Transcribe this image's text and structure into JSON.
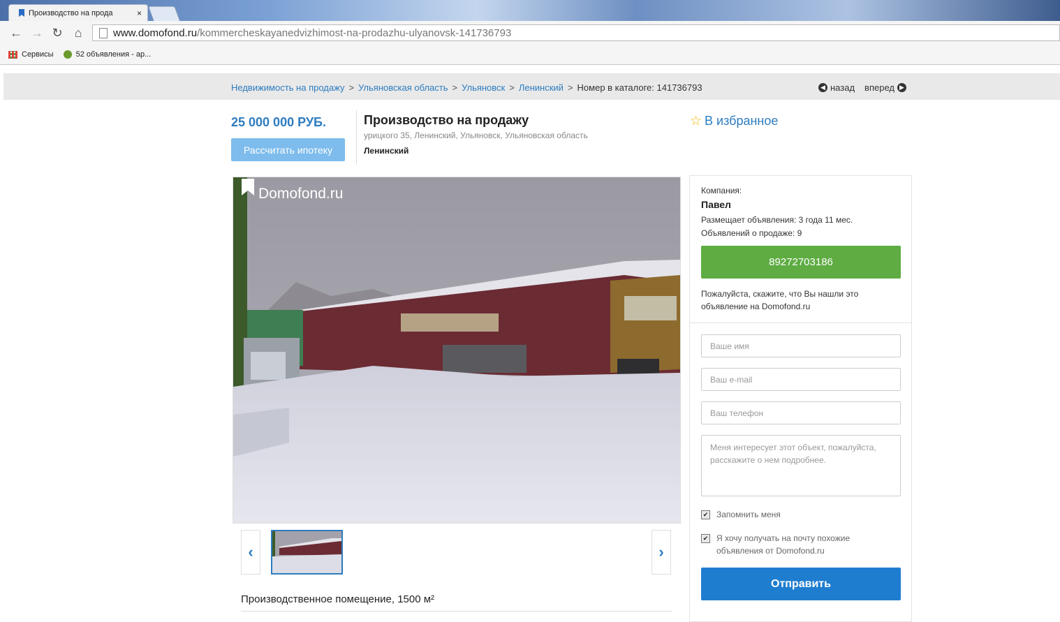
{
  "browser": {
    "tab_title": "Производство на прода",
    "tab_close": "×",
    "url_host": "www.domofond.ru",
    "url_path": "/kommercheskayanedvizhimost-na-prodazhu-ulyanovsk-141736793",
    "bookmarks": [
      {
        "label": "Сервисы",
        "icon": "apps-grid-icon"
      },
      {
        "label": "52 объявления - ар...",
        "icon": "site-icon"
      }
    ]
  },
  "breadcrumb": {
    "items": [
      "Недвижимость на продажу",
      "Ульяновская область",
      "Ульяновск",
      "Ленинский"
    ],
    "separator": ">",
    "catalog": "Номер в каталоге: 141736793",
    "back": "назад",
    "forward": "вперед"
  },
  "listing": {
    "price": "25 000 000 РУБ.",
    "mortgage_button": "Рассчитать ипотеку",
    "title": "Производство на продажу",
    "address": "урицкого 35, Ленинский, Ульяновск, Ульяновская область",
    "district": "Ленинский",
    "favorite": "В избранное"
  },
  "gallery": {
    "watermark": "Domofond.ru",
    "prev": "‹",
    "next": "›"
  },
  "description": {
    "heading": "Производственное помещение, 1500 м²"
  },
  "seller": {
    "company_label": "Компания:",
    "name": "Павел",
    "tenure": "Размещает объявления: 3 года 11 мес.",
    "listings_count": "Объявлений о продаже: 9",
    "phone": "89272703186",
    "hint": "Пожалуйста, скажите, что Вы нашли это объявление на Domofond.ru"
  },
  "form": {
    "name_placeholder": "Ваше имя",
    "email_placeholder": "Ваш e-mail",
    "phone_placeholder": "Ваш телефон",
    "message_placeholder": "Меня интересует этот объект, пожалуйста, расскажите о нем подробнее.",
    "remember_label": "Запомнить меня",
    "subscribe_label": "Я хочу получать на почту похожие объявления от Domofond.ru",
    "check_mark": "✔",
    "submit": "Отправить"
  }
}
